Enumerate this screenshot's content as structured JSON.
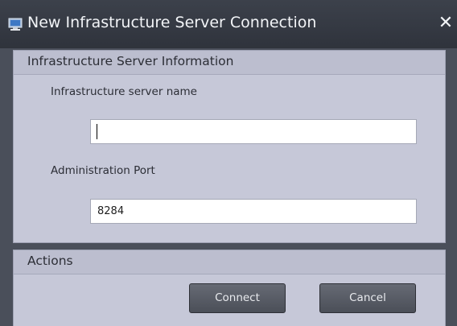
{
  "window": {
    "title": "New Infrastructure Server Connection",
    "icon": "computer-monitor-icon",
    "close_icon": "close-icon"
  },
  "info_section": {
    "header": "Infrastructure Server Information",
    "server_name_label": "Infrastructure server name",
    "server_name_value": "",
    "admin_port_label": "Administration Port",
    "admin_port_value": "8284"
  },
  "actions_section": {
    "header": "Actions",
    "connect_label": "Connect",
    "cancel_label": "Cancel"
  },
  "colors": {
    "titlebar": "#2f333c",
    "panel": "#c6c8d8",
    "button": "#55595f"
  }
}
